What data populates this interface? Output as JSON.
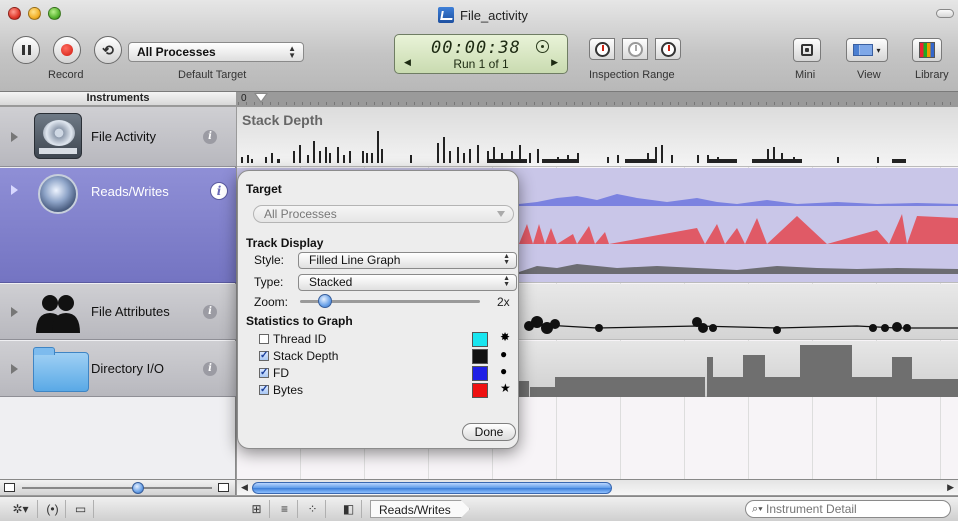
{
  "window": {
    "title": "File_activity"
  },
  "toolbar": {
    "record_label": "Record",
    "target_value": "All Processes",
    "target_label": "Default Target",
    "time": "00:00:38",
    "run": "Run 1 of 1",
    "inspection_range_label": "Inspection Range",
    "mini_label": "Mini",
    "view_label": "View",
    "library_label": "Library"
  },
  "header": {
    "instruments": "Instruments",
    "ruler_zero": "0"
  },
  "instruments": [
    {
      "name": "File Activity",
      "icon": "hard-disk-icon"
    },
    {
      "name": "Reads/Writes",
      "icon": "disk-platter-icon",
      "selected": true
    },
    {
      "name": "File Attributes",
      "icon": "people-icon"
    },
    {
      "name": "Directory I/O",
      "icon": "folder-icon"
    }
  ],
  "tracks": {
    "stack_depth_title": "Stack Depth"
  },
  "inspector": {
    "target_heading": "Target",
    "target_value": "All Processes",
    "track_display_heading": "Track Display",
    "style_label": "Style:",
    "style_value": "Filled Line Graph",
    "type_label": "Type:",
    "type_value": "Stacked",
    "zoom_label": "Zoom:",
    "zoom_value": "2x",
    "zoom_level_fraction": 0.14,
    "stats_heading": "Statistics to Graph",
    "statistics": [
      {
        "name": "Thread ID",
        "checked": false,
        "color": "#19e6f0",
        "marker": "✸"
      },
      {
        "name": "Stack Depth",
        "checked": true,
        "color": "#111111",
        "marker": "●"
      },
      {
        "name": "FD",
        "checked": true,
        "color": "#1f1fe6",
        "marker": "●"
      },
      {
        "name": "Bytes",
        "checked": true,
        "color": "#ee1111",
        "marker": "★"
      }
    ],
    "done_label": "Done"
  },
  "status_bar": {
    "breadcrumb": "Reads/Writes",
    "search_placeholder": "Instrument Detail"
  },
  "colors": {
    "selected_row": "#7f7fcc",
    "bytes_series": "#e05a66",
    "fd_series": "#7b82e0"
  }
}
